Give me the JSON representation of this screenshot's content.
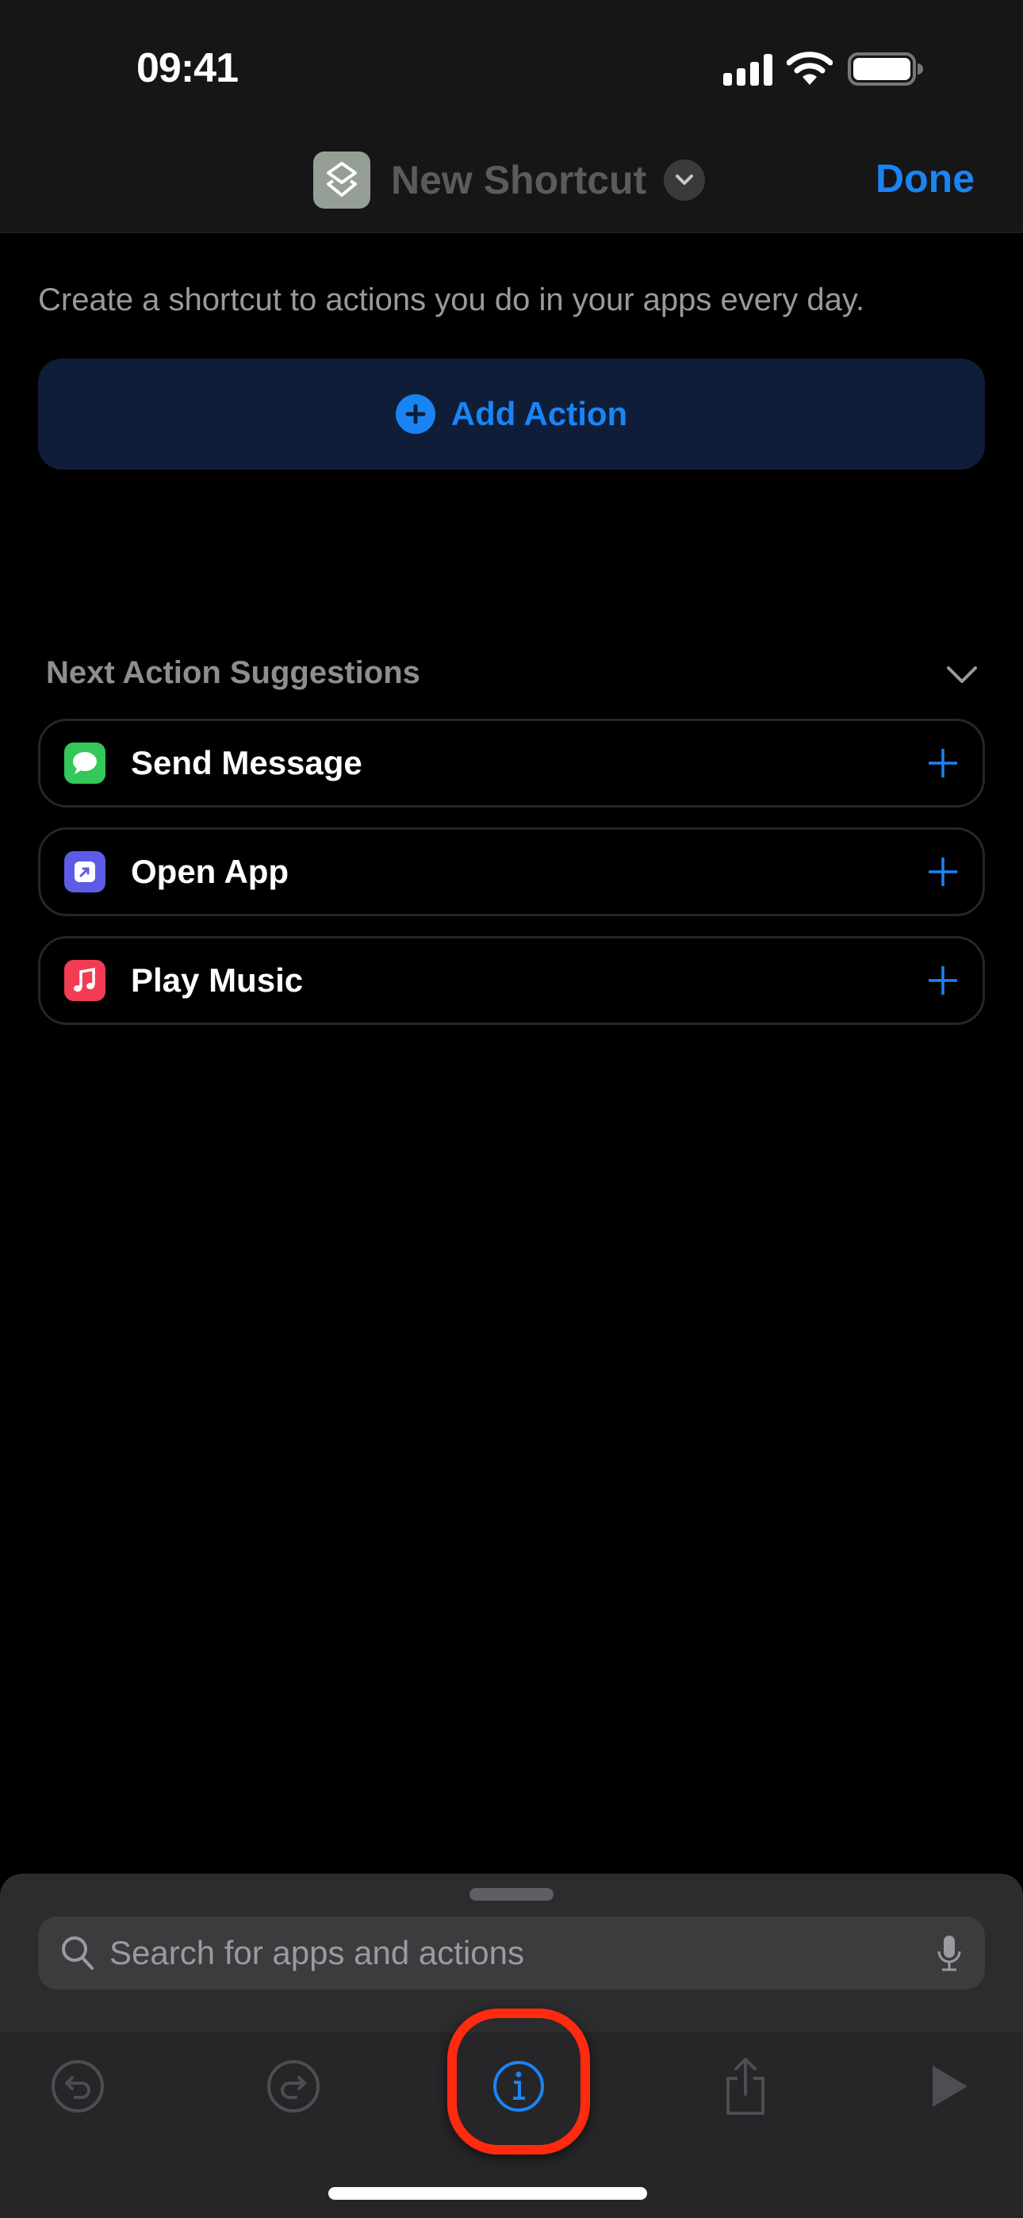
{
  "status_bar": {
    "time": "09:41",
    "icons": [
      "cellular-signal-icon",
      "wifi-icon",
      "battery-icon"
    ]
  },
  "nav": {
    "app_icon": "shortcuts-icon",
    "title": "New Shortcut",
    "title_menu_icon": "chevron-down-icon",
    "done_label": "Done"
  },
  "main": {
    "subtitle": "Create a shortcut to actions you do in your apps every day.",
    "add_action": {
      "icon": "plus-circle-icon",
      "label": "Add Action"
    }
  },
  "suggestions": {
    "header": "Next Action Suggestions",
    "collapse_icon": "chevron-down-icon",
    "items": [
      {
        "label": "Send Message",
        "icon": "messages-icon",
        "icon_color": "#34c759",
        "add_icon": "plus-icon"
      },
      {
        "label": "Open App",
        "icon": "open-app-icon",
        "icon_color": "#5e5ce6",
        "add_icon": "plus-icon"
      },
      {
        "label": "Play Music",
        "icon": "music-icon",
        "icon_color": "#f23c54",
        "add_icon": "plus-icon"
      }
    ]
  },
  "bottom_panel": {
    "search": {
      "placeholder": "Search for apps and actions",
      "value": "",
      "icon": "search-icon",
      "mic_icon": "microphone-icon"
    },
    "toolbar": [
      {
        "name": "undo",
        "icon": "undo-icon",
        "enabled": false
      },
      {
        "name": "redo",
        "icon": "redo-icon",
        "enabled": false
      },
      {
        "name": "info",
        "icon": "info-icon",
        "enabled": true,
        "highlighted": true
      },
      {
        "name": "share",
        "icon": "share-icon",
        "enabled": false
      },
      {
        "name": "run",
        "icon": "play-icon",
        "enabled": false
      }
    ]
  },
  "colors": {
    "accent": "#1a84f5",
    "highlight_ring": "#ff2a10",
    "background": "#000000",
    "panel": "#2c2c2e"
  }
}
